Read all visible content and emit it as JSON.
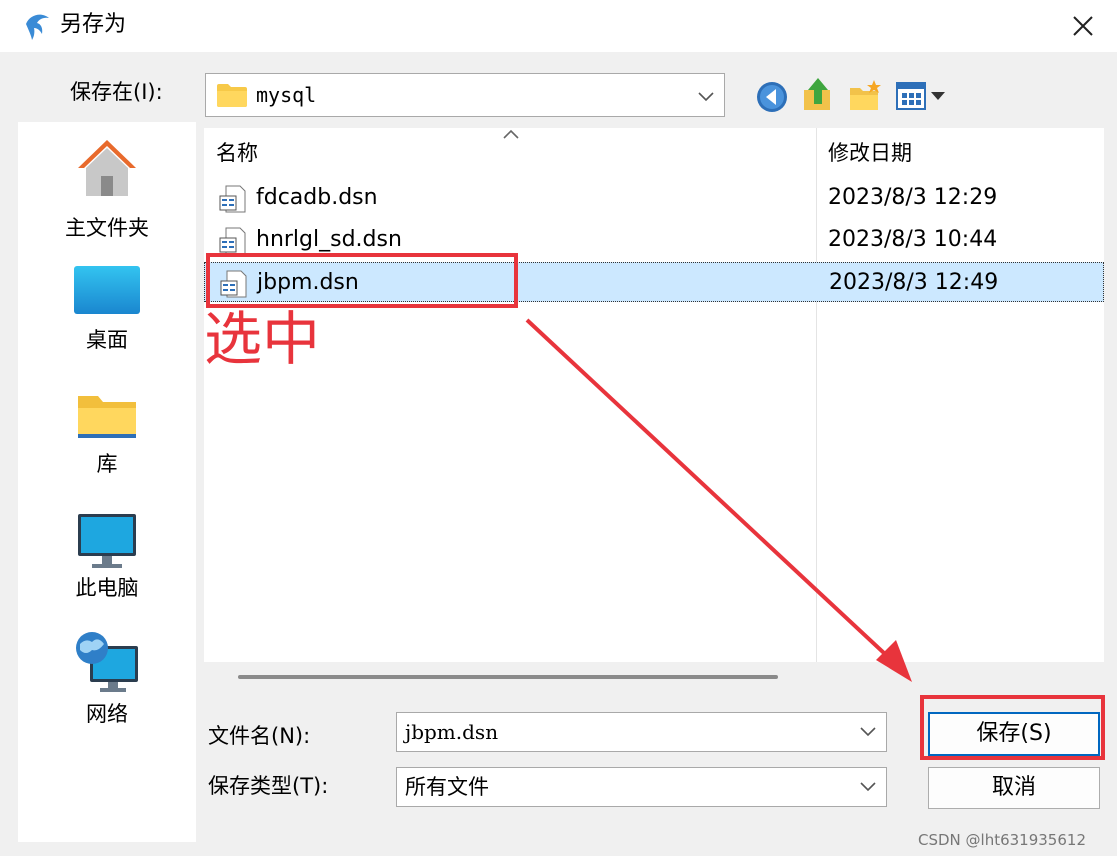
{
  "window": {
    "title": "另存为",
    "app_icon": "dolphin-icon",
    "close_icon": "close-icon"
  },
  "location": {
    "label": "保存在(I):",
    "value": "mysql",
    "icon": "folder-icon"
  },
  "toolbar": {
    "icons": [
      "back-icon",
      "up-folder-icon",
      "new-folder-icon",
      "view-menu-icon"
    ]
  },
  "places": [
    {
      "label": "主文件夹",
      "icon": "home-icon"
    },
    {
      "label": "桌面",
      "icon": "desktop-icon"
    },
    {
      "label": "库",
      "icon": "library-folder-icon"
    },
    {
      "label": "此电脑",
      "icon": "computer-icon"
    },
    {
      "label": "网络",
      "icon": "network-icon"
    }
  ],
  "filelist": {
    "columns": [
      "名称",
      "修改日期"
    ],
    "files": [
      {
        "name": "fdcadb.dsn",
        "date": "2023/8/3 12:29",
        "selected": false
      },
      {
        "name": "hnrlgl_sd.dsn",
        "date": "2023/8/3 10:44",
        "selected": false
      },
      {
        "name": "jbpm.dsn",
        "date": "2023/8/3 12:49",
        "selected": true
      }
    ]
  },
  "filename": {
    "label": "文件名(N):",
    "value": "jbpm.dsn"
  },
  "filetype": {
    "label": "保存类型(T):",
    "value": "所有文件"
  },
  "buttons": {
    "save": "保存(S)",
    "cancel": "取消"
  },
  "annotation": {
    "text": "选中",
    "color": "#e8343c"
  },
  "watermark": "CSDN @lht631935612",
  "colors": {
    "selection": "#cce8ff",
    "accent": "#0067c0",
    "annotation": "#e8343c"
  }
}
